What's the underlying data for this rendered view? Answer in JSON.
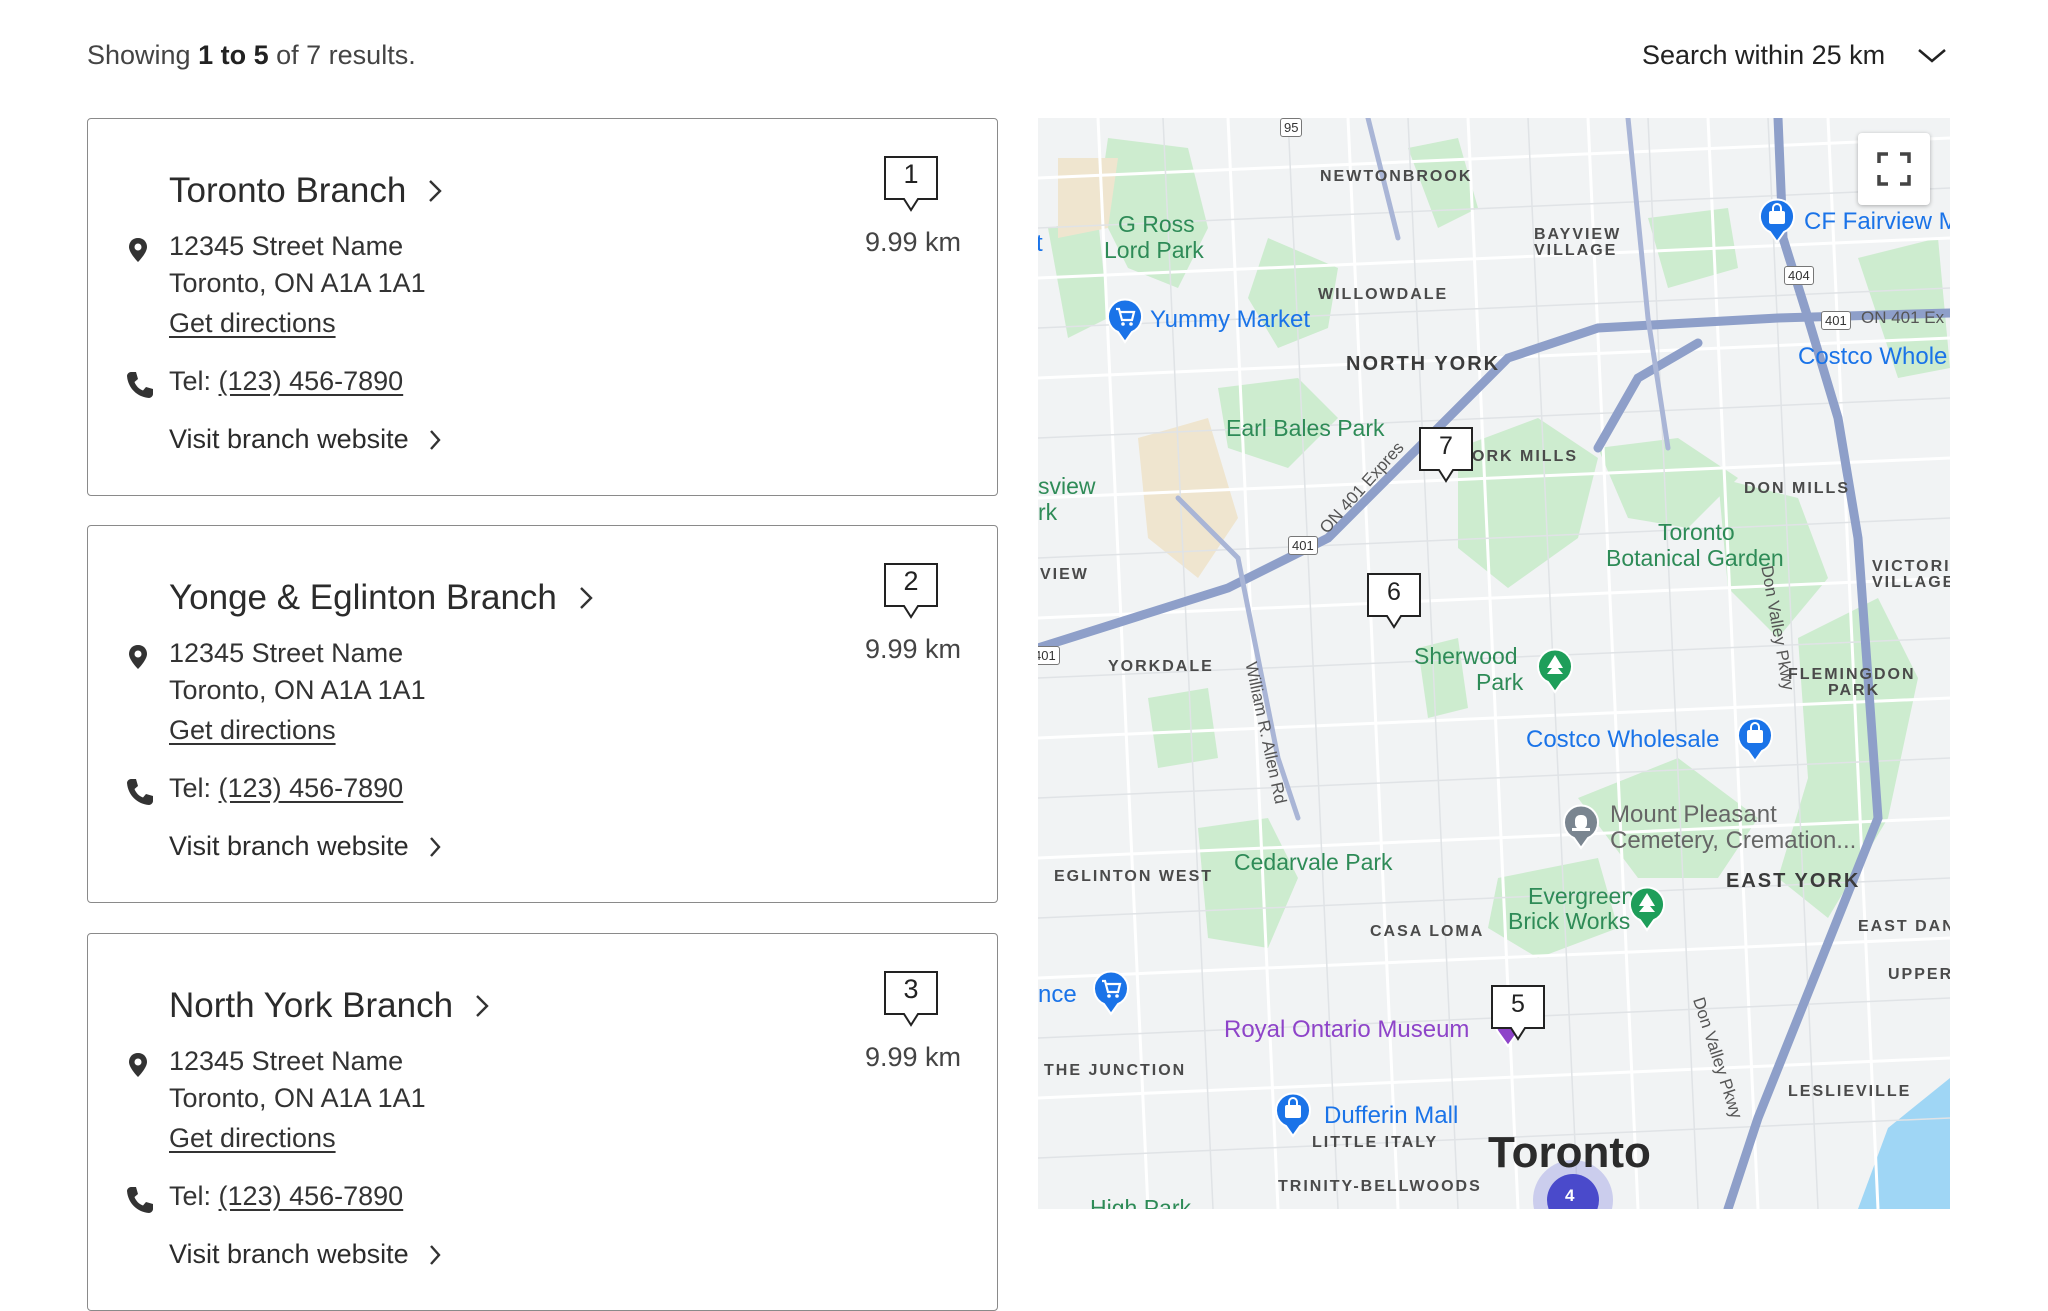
{
  "results_summary": {
    "prefix": "Showing",
    "range": "1 to 5",
    "suffix": "of 7 results."
  },
  "search_radius": {
    "label": "Search within 25 km"
  },
  "branches": [
    {
      "marker": "1",
      "name": "Toronto Branch",
      "address_line1": "12345 Street Name",
      "address_line2": "Toronto, ON A1A 1A1",
      "directions_label": "Get directions",
      "tel_label": "Tel:",
      "tel": "(123) 456-7890",
      "website_label": "Visit branch website",
      "distance": "9.99 km"
    },
    {
      "marker": "2",
      "name": "Yonge & Eglinton Branch",
      "address_line1": "12345 Street Name",
      "address_line2": "Toronto, ON A1A 1A1",
      "directions_label": "Get directions",
      "tel_label": "Tel:",
      "tel": "(123) 456-7890",
      "website_label": "Visit branch website",
      "distance": "9.99 km"
    },
    {
      "marker": "3",
      "name": "North York Branch",
      "address_line1": "12345 Street Name",
      "address_line2": "Toronto, ON A1A 1A1",
      "directions_label": "Get directions",
      "tel_label": "Tel:",
      "tel": "(123) 456-7890",
      "website_label": "Visit branch website",
      "distance": "9.99 km"
    }
  ],
  "map": {
    "markers": [
      "7",
      "6",
      "5"
    ],
    "cluster_count": "4",
    "highways": [
      "95",
      "404",
      "401",
      "401",
      "401",
      "ON 401 Ex"
    ],
    "labels": {
      "newtonbrook": "NEWTONBROOK",
      "bayview_village": [
        "BAYVIEW",
        "VILLAGE"
      ],
      "willowdale": "WILLOWDALE",
      "north_york": "NORTH YORK",
      "york_mills": "ORK MILLS",
      "don_mills": "DON MILLS",
      "victoria_village": [
        "VICTORIA",
        "VILLAGE"
      ],
      "flemingdon_park": [
        "FLEMINGDON",
        "PARK"
      ],
      "view": "VIEW",
      "yorkdale": "YORKDALE",
      "eglinton_west": "EGLINTON WEST",
      "casa_loma": "CASA LOMA",
      "east_york": "EAST YORK",
      "east_danforth": "EAST DANF",
      "upper": "UPPER",
      "the_junction": "THE JUNCTION",
      "little_italy": "LITTLE ITALY",
      "trinity_bellwoods": "TRINITY-BELLWOODS",
      "leslieville": "LESLIEVILLE",
      "toronto": "Toronto",
      "g_ross_lord_park": [
        "G Ross",
        "Lord Park"
      ],
      "earl_bales_park": "Earl Bales Park",
      "sherwood_park": [
        "Sherwood",
        "Park"
      ],
      "toronto_botanical_garden": [
        "Toronto",
        "Botanical Garden"
      ],
      "cedarvale_park": "Cedarvale Park",
      "evergreen_brick_works": [
        "Evergreen",
        "Brick Works"
      ],
      "yummy_market": "Yummy Market",
      "cf_fairview": "CF Fairview M",
      "costco_whole": "Costco Whole",
      "costco_wholesale": "Costco Wholesale",
      "royal_ontario_museum": "Royal Ontario Museum",
      "dufferin_mall": "Dufferin Mall",
      "mount_pleasant": [
        "Mount Pleasant",
        "Cemetery, Cremation..."
      ],
      "ance": "nce",
      "sview": [
        "sview",
        "rk"
      ],
      "william_allen_rd": "William R. Allen Rd",
      "don_valley_pkwy": "Don Valley Pkwy",
      "on401_express": "ON 401 Expres",
      "high_park": "High Park",
      "t_edge": "t"
    }
  },
  "colors": {
    "map_bg": "#f1f3f4",
    "park_green": "#cdeccf",
    "highway": "#8e9fc9",
    "poi_blue": "#1a73e8",
    "park_icon_green": "#1e9e5a",
    "museum_purple": "#8e44c9",
    "water": "#9fd6f5"
  }
}
